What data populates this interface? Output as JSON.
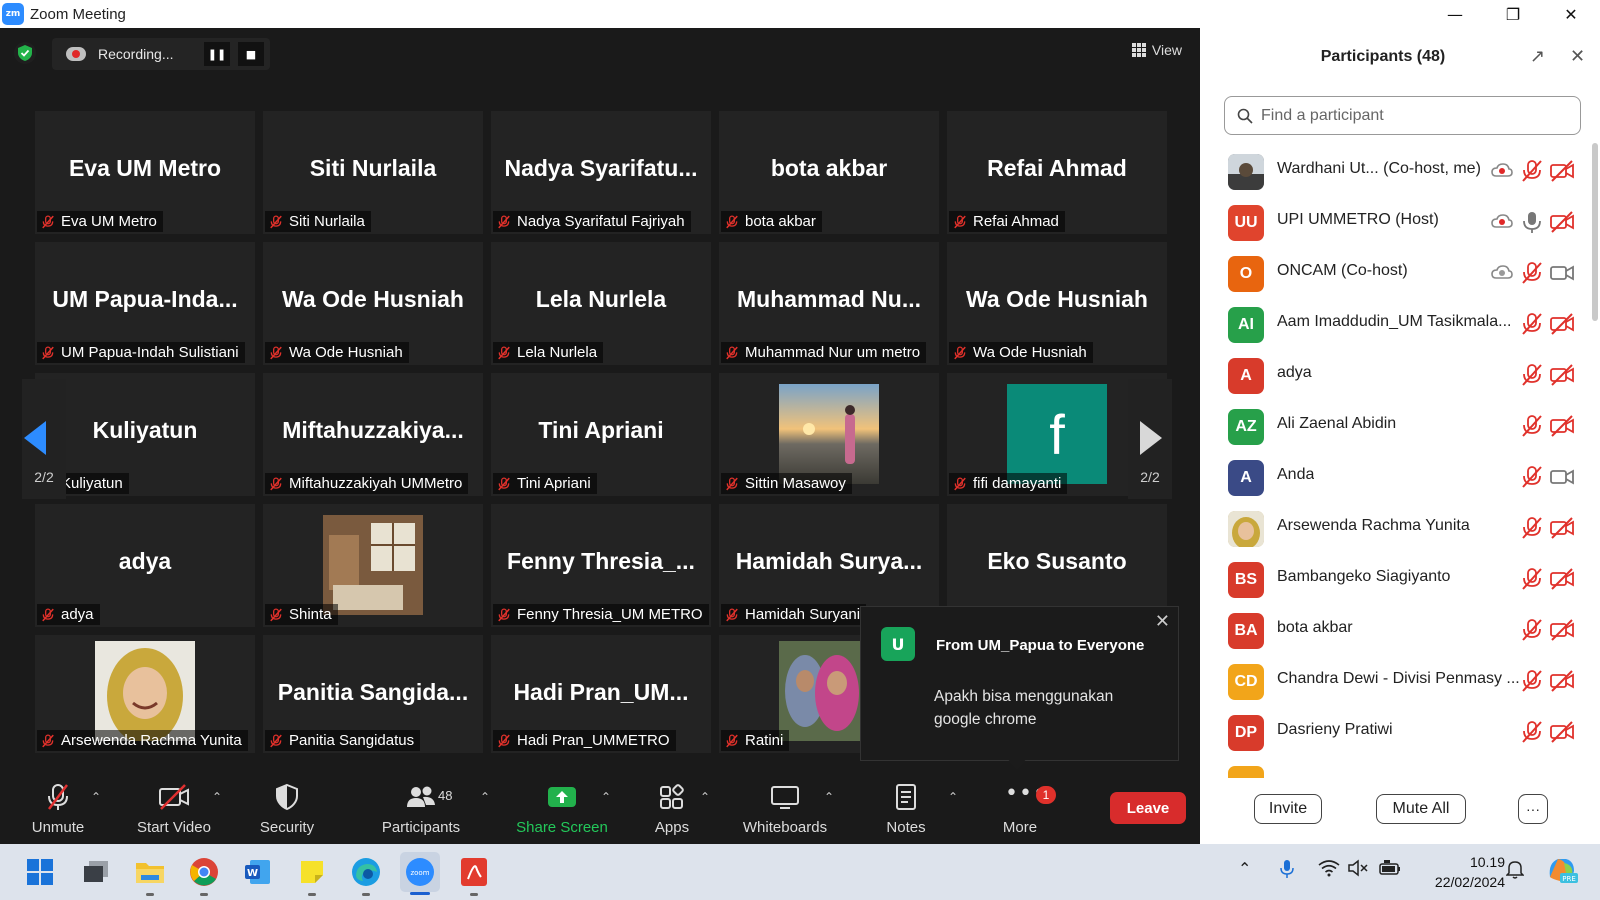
{
  "window": {
    "title": "Zoom Meeting",
    "logo_text": "zm"
  },
  "recording": {
    "status_text": "Recording..."
  },
  "view_label": "View",
  "tiles": [
    {
      "big": "Eva UM Metro",
      "label": "Eva UM Metro"
    },
    {
      "big": "Siti Nurlaila",
      "label": "Siti Nurlaila"
    },
    {
      "big": "Nadya  Syarifatu...",
      "label": "Nadya Syarifatul Fajriyah"
    },
    {
      "big": "bota akbar",
      "label": "bota akbar"
    },
    {
      "big": "Refai Ahmad",
      "label": "Refai Ahmad"
    },
    {
      "big": "UM  Papua-Inda...",
      "label": "UM Papua-Indah Sulistiani"
    },
    {
      "big": "Wa Ode Husniah",
      "label": "Wa Ode Husniah"
    },
    {
      "big": "Lela Nurlela",
      "label": "Lela Nurlela"
    },
    {
      "big": "Muhammad  Nu...",
      "label": "Muhammad Nur um metro"
    },
    {
      "big": "Wa Ode Husniah",
      "label": "Wa Ode Husniah"
    },
    {
      "big": "Kuliyatun",
      "label": "Kuliyatun"
    },
    {
      "big": "Miftahuzzakiya...",
      "label": "Miftahuzzakiyah UMMetro"
    },
    {
      "big": "Tini Apriani",
      "label": "Tini Apriani"
    },
    {
      "big": "",
      "label": "Sittin Masawoy"
    },
    {
      "big": "",
      "label": "fifi damayanti"
    },
    {
      "big": "adya",
      "label": "adya"
    },
    {
      "big": "",
      "label": "Shinta"
    },
    {
      "big": "Fenny  Thresia_...",
      "label": "Fenny Thresia_UM METRO"
    },
    {
      "big": "Hamidah  Surya...",
      "label": "Hamidah Suryani"
    },
    {
      "big": "Eko Susanto",
      "label": ""
    },
    {
      "big": "",
      "label": "Arsewenda Rachma Yunita"
    },
    {
      "big": "Panitia  Sangida...",
      "label": "Panitia Sangidatus"
    },
    {
      "big": "Hadi  Pran_UM...",
      "label": "Hadi Pran_UMMETRO"
    },
    {
      "big": "",
      "label": "Ratini"
    }
  ],
  "fifi_avatar_letter": "f",
  "paging": {
    "left": "2/2",
    "right": "2/2"
  },
  "chat_popup": {
    "avatar_letter": "U",
    "from": "From UM_Papua to Everyone",
    "message": "Apakh bisa menggunakan google chrome"
  },
  "toolbar": {
    "unmute": "Unmute",
    "start_video": "Start Video",
    "security": "Security",
    "participants": "Participants",
    "participants_count": "48",
    "share_screen": "Share Screen",
    "apps": "Apps",
    "whiteboards": "Whiteboards",
    "notes": "Notes",
    "more": "More",
    "more_badge": "1",
    "leave": "Leave"
  },
  "panel": {
    "title": "Participants (48)",
    "search_placeholder": "Find a participant",
    "invite": "Invite",
    "mute_all": "Mute All",
    "participants": [
      {
        "initials": "",
        "name": "Wardhani Ut...  (Co-host, me)",
        "color": "#6b6b6b"
      },
      {
        "initials": "UU",
        "name": "UPI UMMETRO (Host)",
        "color": "#e0442d"
      },
      {
        "initials": "O",
        "name": "ONCAM (Co-host)",
        "color": "#e8650f"
      },
      {
        "initials": "AI",
        "name": "Aam Imaddudin_UM Tasikmala...",
        "color": "#27a04a"
      },
      {
        "initials": "A",
        "name": "adya",
        "color": "#d83b2b"
      },
      {
        "initials": "AZ",
        "name": "Ali Zaenal Abidin",
        "color": "#27a04a"
      },
      {
        "initials": "A",
        "name": "Anda",
        "color": "#3a4a86"
      },
      {
        "initials": "",
        "name": "Arsewenda Rachma Yunita",
        "color": "#c8b27a"
      },
      {
        "initials": "BS",
        "name": "Bambangeko Siagiyanto",
        "color": "#d83b2b"
      },
      {
        "initials": "BA",
        "name": "bota akbar",
        "color": "#d83b2b"
      },
      {
        "initials": "CD",
        "name": "Chandra Dewi - Divisi Penmasy ...",
        "color": "#f2a51a"
      },
      {
        "initials": "DP",
        "name": "Dasrieny Pratiwi",
        "color": "#d83b2b"
      }
    ]
  },
  "taskbar": {
    "time": "10.19",
    "date": "22/02/2024"
  }
}
